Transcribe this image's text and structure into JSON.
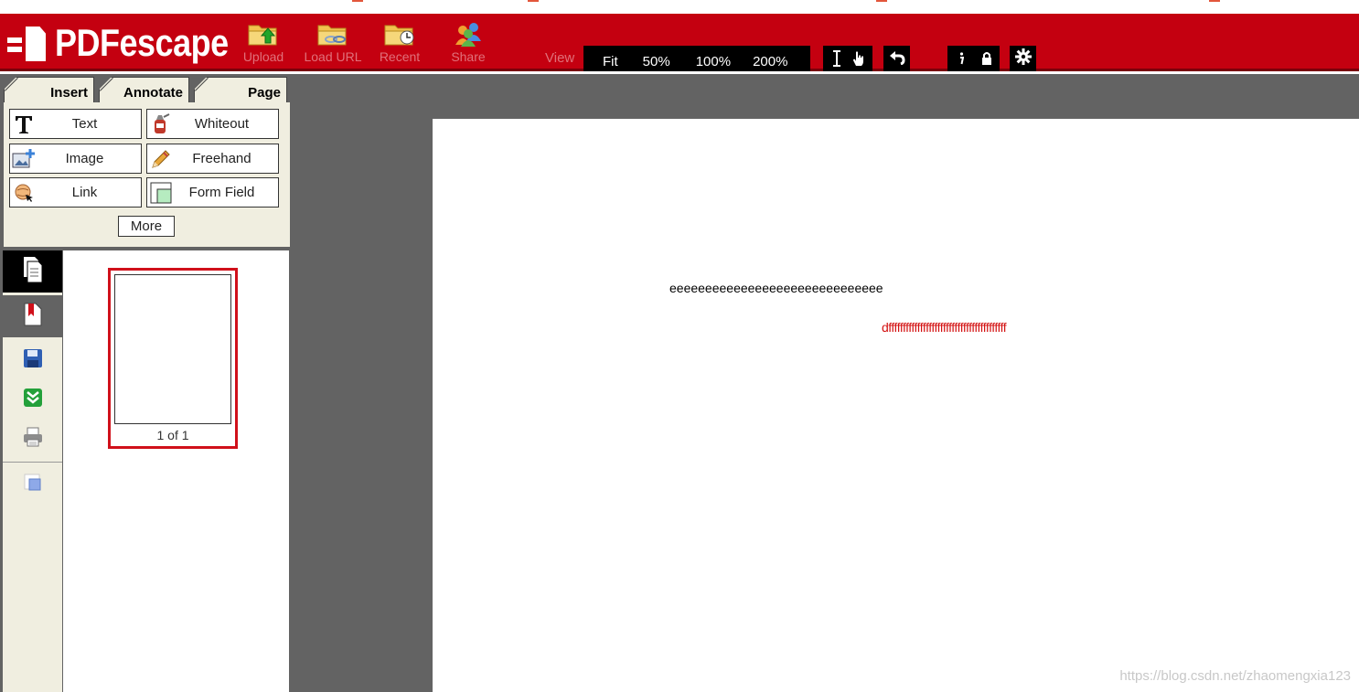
{
  "app": {
    "logo_text": "PDFescape"
  },
  "toolbar": {
    "upload_label": "Upload",
    "load_url_label": "Load URL",
    "recent_label": "Recent",
    "share_label": "Share",
    "view_label": "View",
    "zoom_options": [
      "Fit",
      "50%",
      "100%",
      "200%"
    ]
  },
  "tabs": {
    "insert": "Insert",
    "annotate": "Annotate",
    "page": "Page"
  },
  "tools": {
    "text": "Text",
    "whiteout": "Whiteout",
    "image": "Image",
    "freehand": "Freehand",
    "link": "Link",
    "form_field": "Form Field",
    "more": "More"
  },
  "thumbnails": {
    "caption": "1 of 1"
  },
  "document": {
    "line1": "eeeeeeeeeeeeeeeeeeeeeeeeeeeeee",
    "line2": "dfffffffffffffffffffffffffffffffffffffffff"
  },
  "watermark": "https://blog.csdn.net/zhaomengxia123",
  "colors": {
    "brand_red": "#c40010",
    "panel_beige": "#f0eee0",
    "viewer_gray": "#636363",
    "annotation_red": "#d31010"
  }
}
